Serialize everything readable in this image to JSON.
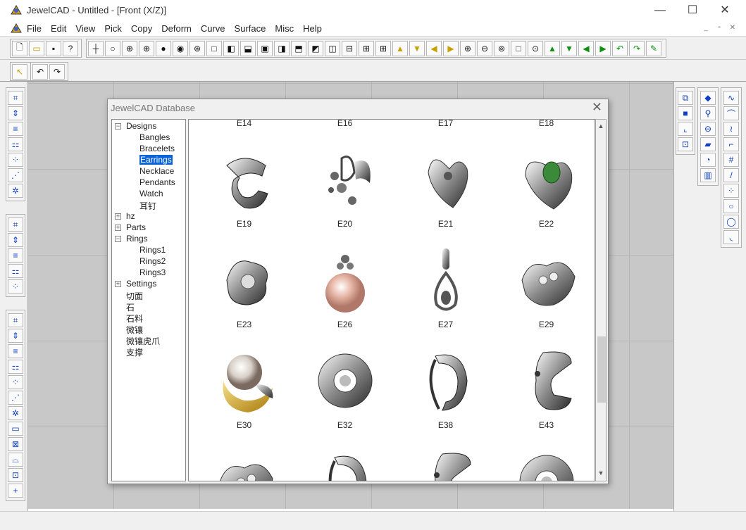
{
  "window": {
    "title": "JewelCAD - Untitled - [Front (X/Z)]",
    "minimize": "—",
    "maximize": "☐",
    "close": "✕"
  },
  "menu": {
    "items": [
      "File",
      "Edit",
      "View",
      "Pick",
      "Copy",
      "Deform",
      "Curve",
      "Surface",
      "Misc",
      "Help"
    ],
    "mdi_min": "_",
    "mdi_restore": "▫",
    "mdi_close": "✕"
  },
  "toolbar1_icons": [
    "new-file",
    "open-folder",
    "save-disk",
    "help-pointer",
    "crosshair",
    "circle",
    "target",
    "globe-grid",
    "filled-circle",
    "sphere",
    "compass",
    "view-single",
    "view-left",
    "view-bottom",
    "view-center",
    "view-right",
    "view-top",
    "view-split-b",
    "view-vsplit",
    "view-hsplit",
    "view-quad",
    "view-grid",
    "triangle-up",
    "triangle-down",
    "triangle-left",
    "triangle-right",
    "zoom-in",
    "zoom-out",
    "zoom-fit",
    "zoom-box",
    "zoom-all",
    "green-up",
    "green-down",
    "green-left",
    "green-right",
    "rotate-left",
    "rotate-right",
    "render-tool"
  ],
  "toolbar2_icons": [
    "select-arrow",
    "undo",
    "redo"
  ],
  "dialog": {
    "title": "JewelCAD Database",
    "close": "✕"
  },
  "tree": {
    "items": [
      {
        "label": "Designs",
        "level": 0,
        "expander": "−"
      },
      {
        "label": "Bangles",
        "level": 1
      },
      {
        "label": "Bracelets",
        "level": 1
      },
      {
        "label": "Earrings",
        "level": 1,
        "selected": true
      },
      {
        "label": "Necklace",
        "level": 1
      },
      {
        "label": "Pendants",
        "level": 1
      },
      {
        "label": "Watch",
        "level": 1
      },
      {
        "label": "耳钉",
        "level": 1
      },
      {
        "label": "hz",
        "level": 0,
        "expander": "+"
      },
      {
        "label": "Parts",
        "level": 0,
        "expander": "+"
      },
      {
        "label": "Rings",
        "level": 0,
        "expander": "−"
      },
      {
        "label": "Rings1",
        "level": 1
      },
      {
        "label": "Rings2",
        "level": 1
      },
      {
        "label": "Rings3",
        "level": 1
      },
      {
        "label": "Settings",
        "level": 0,
        "expander": "+"
      },
      {
        "label": "切面",
        "level": 0
      },
      {
        "label": "石",
        "level": 0
      },
      {
        "label": "石料",
        "level": 0
      },
      {
        "label": "微镶",
        "level": 0
      },
      {
        "label": "微镶虎爪",
        "level": 0
      },
      {
        "label": "支撑",
        "level": 0
      }
    ]
  },
  "gallery": {
    "top_row_labels": [
      "E14",
      "E16",
      "E17",
      "E18"
    ],
    "rows": [
      [
        {
          "label": "E19",
          "kind": "band"
        },
        {
          "label": "E20",
          "kind": "drops"
        },
        {
          "label": "E21",
          "kind": "heart"
        },
        {
          "label": "E22",
          "kind": "heart-green"
        }
      ],
      [
        {
          "label": "E23",
          "kind": "swirl"
        },
        {
          "label": "E26",
          "kind": "pearl-pink"
        },
        {
          "label": "E27",
          "kind": "teardrop"
        },
        {
          "label": "E29",
          "kind": "cluster"
        }
      ],
      [
        {
          "label": "E30",
          "kind": "pearl-gold"
        },
        {
          "label": "E32",
          "kind": "flower"
        },
        {
          "label": "E38",
          "kind": "hoop"
        },
        {
          "label": "E43",
          "kind": "cuff"
        }
      ]
    ],
    "partial_row": [
      "ring-partial",
      "ring-partial",
      "ring-partial",
      "ring-partial"
    ]
  },
  "scrollbar": {
    "up": "▲",
    "down": "▼"
  },
  "colors": {
    "selection": "#0a64d8",
    "workspace": "#c8c8c8",
    "gem_green": "#3a8a3a",
    "pearl_pink": "#e8b8a8",
    "gold": "#d8a820"
  }
}
